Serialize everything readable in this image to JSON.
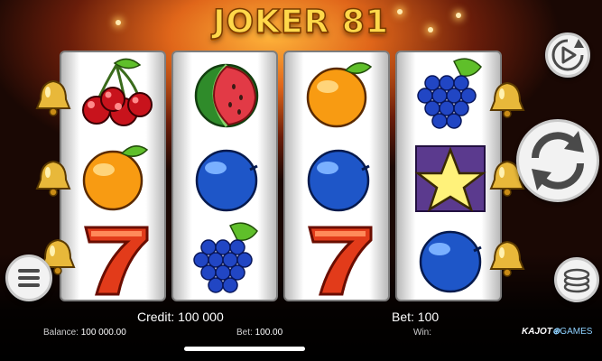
{
  "title": "JOKER 81",
  "reels": [
    {
      "symbols": [
        "cherries",
        "orange",
        "seven"
      ]
    },
    {
      "symbols": [
        "watermelon",
        "plum",
        "grapes"
      ]
    },
    {
      "symbols": [
        "orange",
        "plum",
        "seven"
      ]
    },
    {
      "symbols": [
        "grapes",
        "star",
        "plum"
      ]
    }
  ],
  "hud": {
    "credit_label": "Credit:",
    "credit_value": "100 000",
    "bet_label": "Bet:",
    "bet_value": "100",
    "balance_label": "Balance:",
    "balance_value": "100 000.00",
    "bet_small_label": "Bet:",
    "bet_small_value": "100.00",
    "win_label": "Win:",
    "win_value": ""
  },
  "buttons": {
    "autoplay_icon": "play-circle-icon",
    "spin_icon": "refresh-arrows-icon",
    "menu_icon": "hamburger-icon",
    "coins_icon": "coin-stack-icon"
  },
  "brand": {
    "part1": "KAJOT",
    "part2": "GAMES"
  },
  "colors": {
    "title": "#ffd84a",
    "background_glow": "#e0661a",
    "symbol_frame": "#5b3a8e"
  }
}
